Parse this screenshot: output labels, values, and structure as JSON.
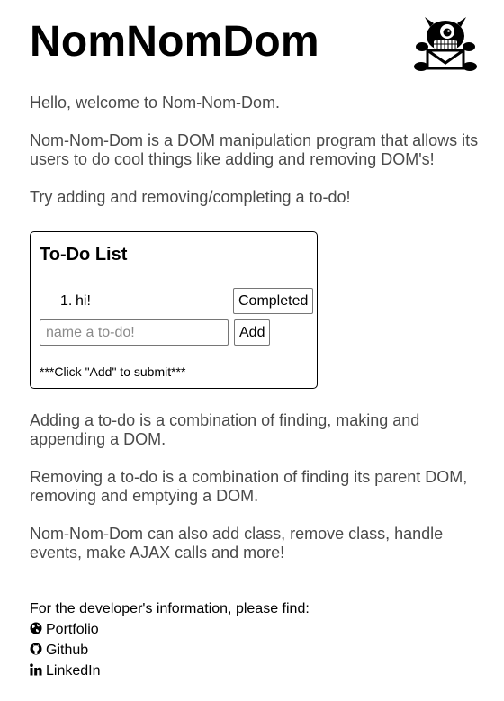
{
  "header": {
    "title": "NomNomDom",
    "logo_icon": "monster-mascot-icon"
  },
  "intro": {
    "welcome": "Hello, welcome to Nom-Nom-Dom.",
    "description": "Nom-Nom-Dom is a DOM manipulation program that allows its users to do cool things like adding and removing DOM's!",
    "prompt": "Try adding and removing/completing a to-do!"
  },
  "todo": {
    "title": "To-Do List",
    "items": [
      {
        "number": "1.",
        "text": "hi!",
        "button_label": "Completed"
      }
    ],
    "input_placeholder": "name a to-do!",
    "input_value": "",
    "add_label": "Add",
    "hint": "***Click \"Add\" to submit***"
  },
  "explain": {
    "adding": "Adding a to-do is a combination of finding, making and appending a DOM.",
    "removing": "Removing a to-do is a combination of finding its parent DOM, removing and emptying a DOM.",
    "more": "Nom-Nom-Dom can also add class, remove class, handle events, make AJAX calls and more!"
  },
  "developer": {
    "intro": "For the developer's information, please find:",
    "links": [
      {
        "label": "Portfolio",
        "icon": "globe-icon"
      },
      {
        "label": "Github",
        "icon": "github-icon"
      },
      {
        "label": "LinkedIn",
        "icon": "linkedin-icon"
      }
    ]
  },
  "colors": {
    "body_text": "#4a4a4a",
    "heading": "#000000",
    "background": "#ffffff"
  }
}
